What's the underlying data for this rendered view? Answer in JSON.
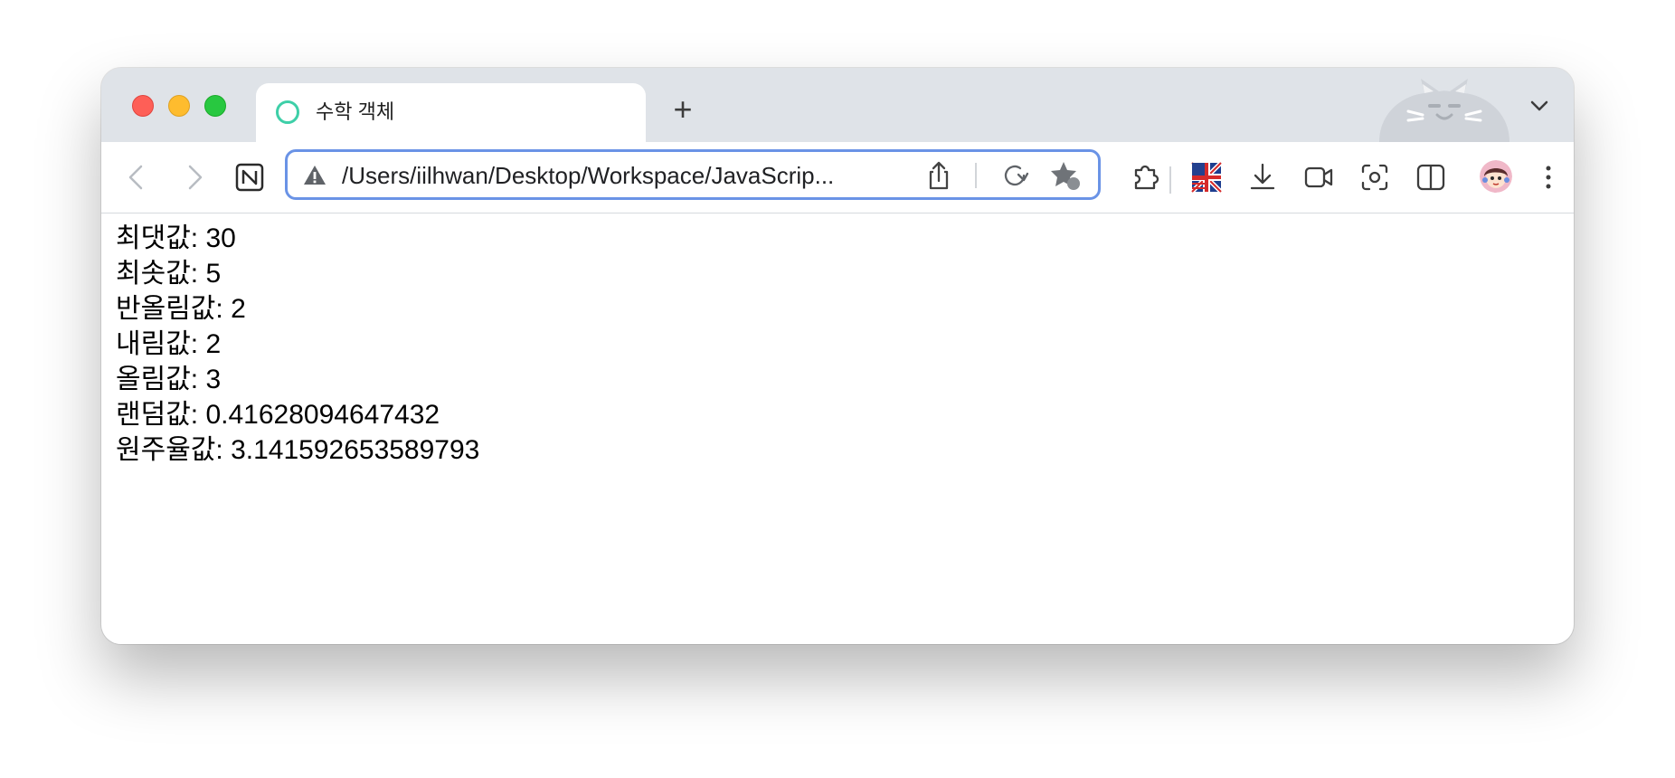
{
  "browser": {
    "tab": {
      "title": "수학 객체"
    },
    "new_tab_label": "+",
    "address_bar": {
      "url": "/Users/iilhwan/Desktop/Workspace/JavaScrip..."
    },
    "colors": {
      "address_focus": "#6a93e6",
      "favicon": "#3ecfa8",
      "close": "#fe5f57",
      "minimize": "#febc2e",
      "maximize": "#28c840"
    }
  },
  "page": {
    "lines": [
      "최댓값: 30",
      "최솟값: 5",
      "반올림값: 2",
      "내림값: 2",
      "올림값: 3",
      "랜덤값: 0.41628094647432",
      "원주율값: 3.141592653589793"
    ]
  }
}
